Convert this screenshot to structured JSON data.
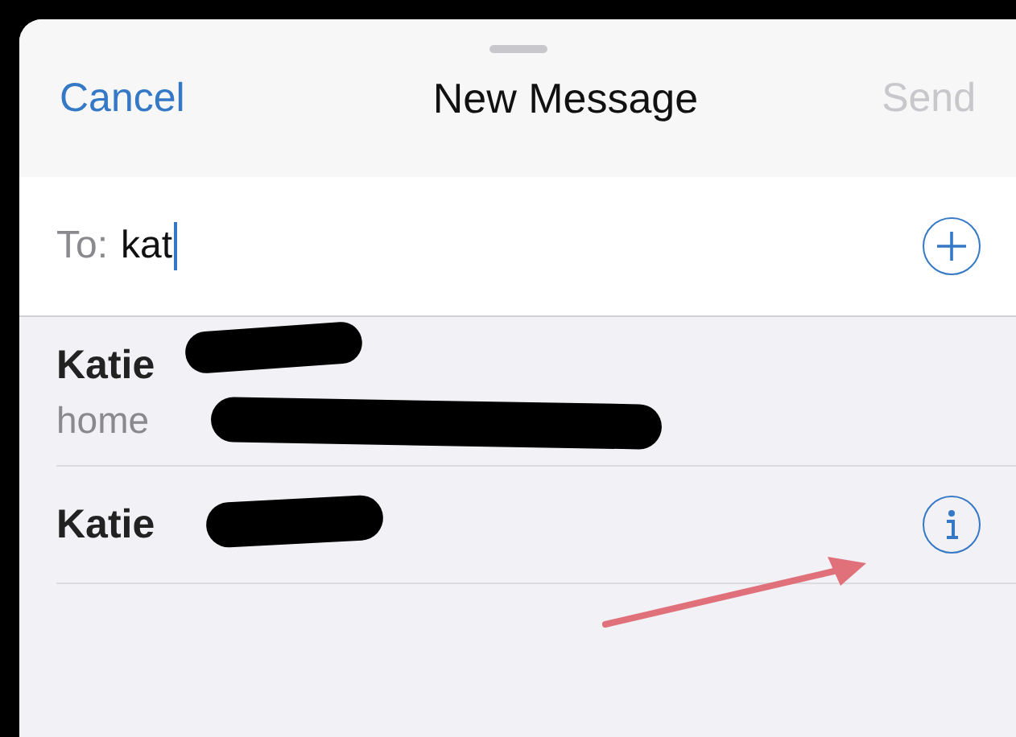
{
  "header": {
    "cancel": "Cancel",
    "title": "New Message",
    "send": {
      "label": "Send",
      "disabled": true
    }
  },
  "to_field": {
    "label": "To:",
    "value": "kat"
  },
  "suggestions": [
    {
      "kind": "address",
      "name": "Katie",
      "detail": "home"
    },
    {
      "kind": "group",
      "name": "Katie"
    }
  ]
}
